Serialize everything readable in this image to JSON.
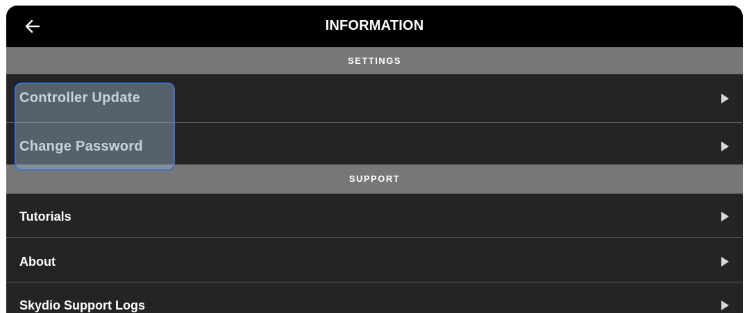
{
  "header": {
    "title": "INFORMATION",
    "back_icon": "arrow-left-icon"
  },
  "sections": [
    {
      "title": "SETTINGS",
      "items": [
        {
          "label": "Controller Update"
        },
        {
          "label": "Change Password"
        }
      ]
    },
    {
      "title": "SUPPORT",
      "items": [
        {
          "label": "Tutorials"
        },
        {
          "label": "About"
        },
        {
          "label": "Skydio Support Logs"
        }
      ]
    }
  ],
  "colors": {
    "titlebar": "#000000",
    "section_header": "#777777",
    "row_background": "#242424",
    "highlight_border": "#3d74c4"
  }
}
